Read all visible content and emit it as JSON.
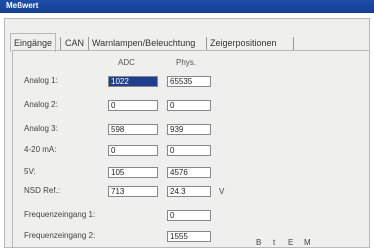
{
  "window": {
    "title": "Meßwert"
  },
  "tabs": [
    {
      "label": "Eingänge",
      "active": true
    },
    {
      "label": "CAN",
      "active": false
    },
    {
      "label": "Warnlampen/Beleuchtung",
      "active": false
    },
    {
      "label": "Zeigerpositionen",
      "active": false
    }
  ],
  "columns": {
    "adc": "ADC",
    "phys": "Phys."
  },
  "rows": [
    {
      "label": "Analog 1:",
      "adc": "1022",
      "phys": "65535",
      "unit": ""
    },
    {
      "label": "Analog 2:",
      "adc": "0",
      "phys": "0",
      "unit": ""
    },
    {
      "label": "Analog 3:",
      "adc": "598",
      "phys": "939",
      "unit": ""
    },
    {
      "label": "4-20 mA:",
      "adc": "0",
      "phys": "0",
      "unit": ""
    },
    {
      "label": "5V:",
      "adc": "105",
      "phys": "4576",
      "unit": ""
    },
    {
      "label": "NSD Ref.:",
      "adc": "713",
      "phys": "24.3",
      "unit": "V"
    },
    {
      "label": "Frequenzeingang 1:",
      "adc": "",
      "phys": "0",
      "unit": ""
    },
    {
      "label": "Frequenzeingang 2:",
      "adc": "",
      "phys": "1555",
      "unit": ""
    }
  ],
  "toolbar": {
    "icons": [
      "B",
      "t",
      "E",
      "M"
    ]
  },
  "colors": {
    "selection": "#1f3f8c",
    "titlebar": "#1e4ea8"
  }
}
